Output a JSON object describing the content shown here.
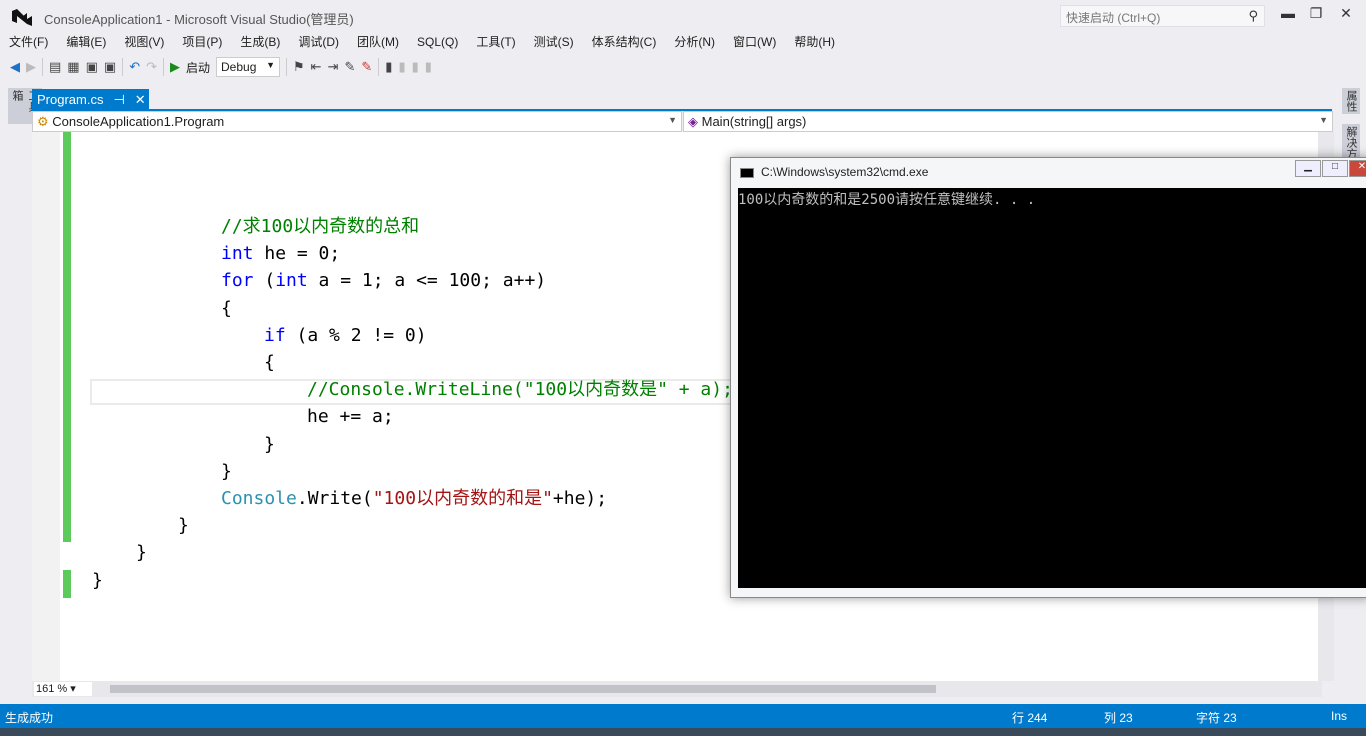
{
  "window": {
    "title": "ConsoleApplication1 - Microsoft Visual Studio(管理员)",
    "quick_launch_placeholder": "快速启动 (Ctrl+Q)"
  },
  "menu": [
    "文件(F)",
    "编辑(E)",
    "视图(V)",
    "项目(P)",
    "生成(B)",
    "调试(D)",
    "团队(M)",
    "SQL(Q)",
    "工具(T)",
    "测试(S)",
    "体系结构(C)",
    "分析(N)",
    "窗口(W)",
    "帮助(H)"
  ],
  "toolbar": {
    "start_label": "启动",
    "config": "Debug"
  },
  "side": {
    "left": "工具箱",
    "right1": "属性",
    "right2": "解决方"
  },
  "tab": {
    "label": "Program.cs"
  },
  "nav": {
    "class": "ConsoleApplication1.Program",
    "member": "Main(string[] args)"
  },
  "code": [
    [
      {
        "t": "//求100以内奇数的总和",
        "c": "cm"
      }
    ],
    [
      {
        "t": "int",
        "c": "kw"
      },
      {
        "t": " he = 0;",
        "c": ""
      }
    ],
    [
      {
        "t": "for",
        "c": "kw"
      },
      {
        "t": " (",
        "c": ""
      },
      {
        "t": "int",
        "c": "kw"
      },
      {
        "t": " a = 1; a <= 100; a++)",
        "c": ""
      }
    ],
    [
      {
        "t": "{",
        "c": ""
      }
    ],
    [
      {
        "t": "if",
        "c": "kw"
      },
      {
        "t": " (a % 2 != 0)",
        "c": ""
      }
    ],
    [
      {
        "t": "{",
        "c": ""
      }
    ],
    [
      {
        "t": "//Console.WriteLine(\"100以内奇数是\" + a);",
        "c": "cm"
      }
    ],
    [
      {
        "t": "he += a;",
        "c": ""
      }
    ],
    [
      {
        "t": "}",
        "c": ""
      }
    ],
    [
      {
        "t": "}",
        "c": ""
      }
    ],
    [
      {
        "t": "Console",
        "c": "ty"
      },
      {
        "t": ".Write(",
        "c": ""
      },
      {
        "t": "\"100以内奇数的和是\"",
        "c": "st"
      },
      {
        "t": "+he);",
        "c": ""
      }
    ],
    [
      {
        "t": "}",
        "c": ""
      }
    ],
    [
      {
        "t": "}",
        "c": ""
      }
    ],
    [
      {
        "t": "}",
        "c": ""
      }
    ]
  ],
  "zoom": "161 %",
  "status": {
    "message": "生成成功",
    "line": "行 244",
    "col": "列 23",
    "char": "字符 23",
    "mode": "Ins"
  },
  "cmd": {
    "title": "C:\\Windows\\system32\\cmd.exe",
    "output": "100以内奇数的和是2500请按任意键继续. . ."
  }
}
